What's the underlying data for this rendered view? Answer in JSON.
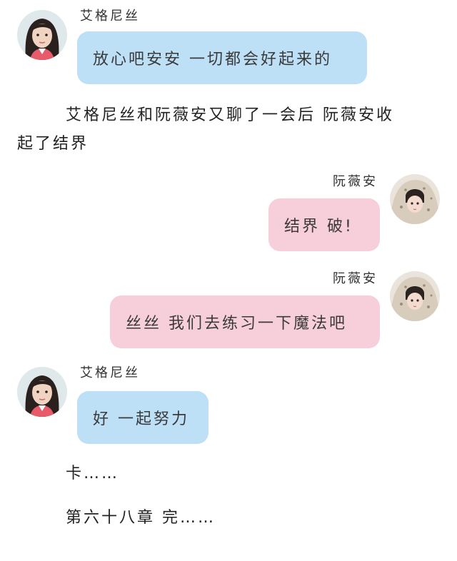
{
  "messages": [
    {
      "sender": "艾格尼丝",
      "side": "left",
      "bubble_color": "#bde0f7",
      "text": "放心吧安安 一切都会好起来的"
    },
    {
      "sender": "阮薇安",
      "side": "right",
      "bubble_color": "#f7cfdb",
      "text": "结界 破!"
    },
    {
      "sender": "阮薇安",
      "side": "right",
      "bubble_color": "#f7cfdb",
      "text": "丝丝 我们去练习一下魔法吧"
    },
    {
      "sender": "艾格尼丝",
      "side": "left",
      "bubble_color": "#bde0f7",
      "text": "好 一起努力"
    }
  ],
  "narration": {
    "line1": "艾格尼丝和阮薇安又聊了一会后 阮薇安收",
    "line2": "起了结界",
    "ka": "卡……",
    "chapter_end": "第六十八章 完……"
  },
  "icons": {
    "left_avatar": "woman-portrait-avatar",
    "right_avatar": "child-blanket-avatar"
  }
}
